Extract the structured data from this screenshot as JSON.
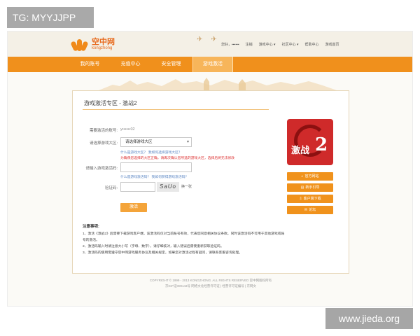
{
  "watermarks": {
    "top_left": "TG: MYYJJPP",
    "bottom_right": "www.jieda.org"
  },
  "header": {
    "logo_cn": "空中网",
    "logo_en": "kongzhong",
    "top_links": [
      "您好，▪▪▪▪▪▪",
      "注销",
      "游戏中心 ▾",
      "社区中心 ▾",
      "帮助中心",
      "游戏首页"
    ]
  },
  "nav": {
    "items": [
      "我的账号",
      "充值中心",
      "安全管理",
      "游戏激活"
    ],
    "active_index": 3
  },
  "card": {
    "title": "游戏激活专区 - 激战2",
    "account_label": "需要激活的账号:",
    "account_value": "y▪▪▪▪▪▪02",
    "server_label": "请选择游戏大区:",
    "server_select": "请选择游戏大区",
    "server_hint": "什么是游戏大区？ 我如何选择游戏大区？",
    "server_warning": "为确保您选择的大区正确，请再次确认您所选的游戏大区，选择后将无法修改",
    "code_label": "请输入游戏激活码:",
    "code_hint": "什么是游戏激活码？ 我如何获得游戏激活码？",
    "captcha_label": "验证码:",
    "captcha_image_text": "SaUo",
    "captcha_refresh": "换一张",
    "submit": "激活"
  },
  "notes": {
    "title": "注意事项:",
    "items": [
      "1、激活《激战2》后需要下载游戏客户端，该激活码仅对当前账号有效，代表您同意相关协议条款。同时该激活码不可用于其他游戏或账号的激活。",
      "2、激活码输入时请注意大小写（字母、数字），请仔细核对，输入错误后需要重新获取验证码。",
      "3、激活码的使用需遵守空中网游戏服务协议及相关规定，如果您对激活过程有疑问，请联系客服咨询处理。"
    ]
  },
  "sidebar": {
    "game_name": "激战",
    "game_numeral": "2",
    "buttons": [
      {
        "label": "官方网站",
        "icon": "home-icon"
      },
      {
        "label": "新手引导",
        "icon": "book-icon"
      },
      {
        "label": "客户端下载",
        "icon": "download-icon"
      },
      {
        "label": "论坛",
        "icon": "chat-icon"
      }
    ]
  },
  "footer": {
    "line1": "COPYRIGHT © 1999 - 2013 KONGZHONG. ALL RIGHTS RESERVED  空中网版权所有",
    "line2": "京ICP证000143号  网络文化经营许可证  |  经营许可证编号  |  京网文"
  },
  "colors": {
    "nav": "#f0901c",
    "accent": "#f4a43a",
    "brand": "#e7691c"
  }
}
